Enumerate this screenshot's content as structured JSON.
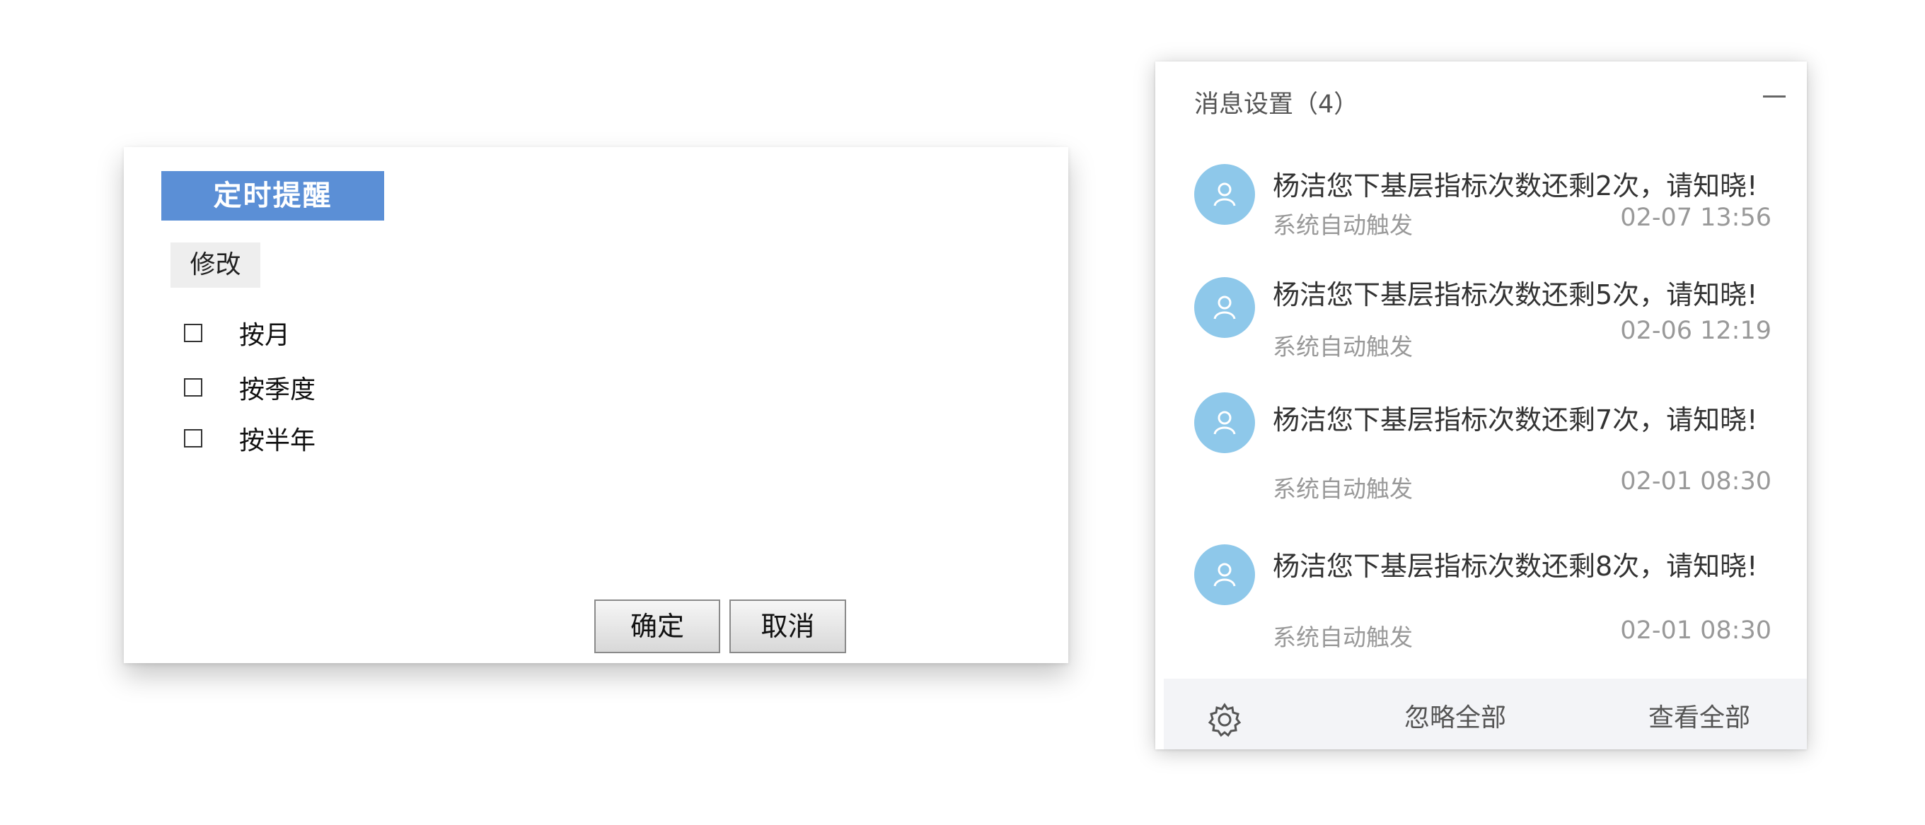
{
  "dialog": {
    "title": "定时提醒",
    "tab": "修改",
    "options": [
      {
        "label": "按月",
        "checked": false
      },
      {
        "label": "按季度",
        "checked": false
      },
      {
        "label": "按半年",
        "checked": false
      }
    ],
    "confirm_label": "确定",
    "cancel_label": "取消"
  },
  "panel": {
    "title": "消息设置（4）",
    "minimize_icon": "minus-icon",
    "messages": [
      {
        "text": "杨洁您下基层指标次数还剩2次，请知晓!",
        "source": "系统自动触发",
        "time": "02-07 13:56",
        "avatar": "user-avatar-icon"
      },
      {
        "text": "杨洁您下基层指标次数还剩5次，请知晓!",
        "source": "系统自动触发",
        "time": "02-06 12:19",
        "avatar": "user-avatar-icon"
      },
      {
        "text": "杨洁您下基层指标次数还剩7次，请知晓!",
        "source": "系统自动触发",
        "time": "02-01 08:30",
        "avatar": "user-avatar-icon"
      },
      {
        "text": "杨洁您下基层指标次数还剩8次，请知晓!",
        "source": "系统自动触发",
        "time": "02-01 08:30",
        "avatar": "user-avatar-icon"
      }
    ],
    "footer": {
      "settings_icon": "gear-icon",
      "ignore_all": "忽略全部",
      "view_all": "查看全部"
    }
  },
  "colors": {
    "title_bar": "#5b8fd6",
    "avatar": "#8ec8ea",
    "footer_bg": "#f3f4f7"
  }
}
